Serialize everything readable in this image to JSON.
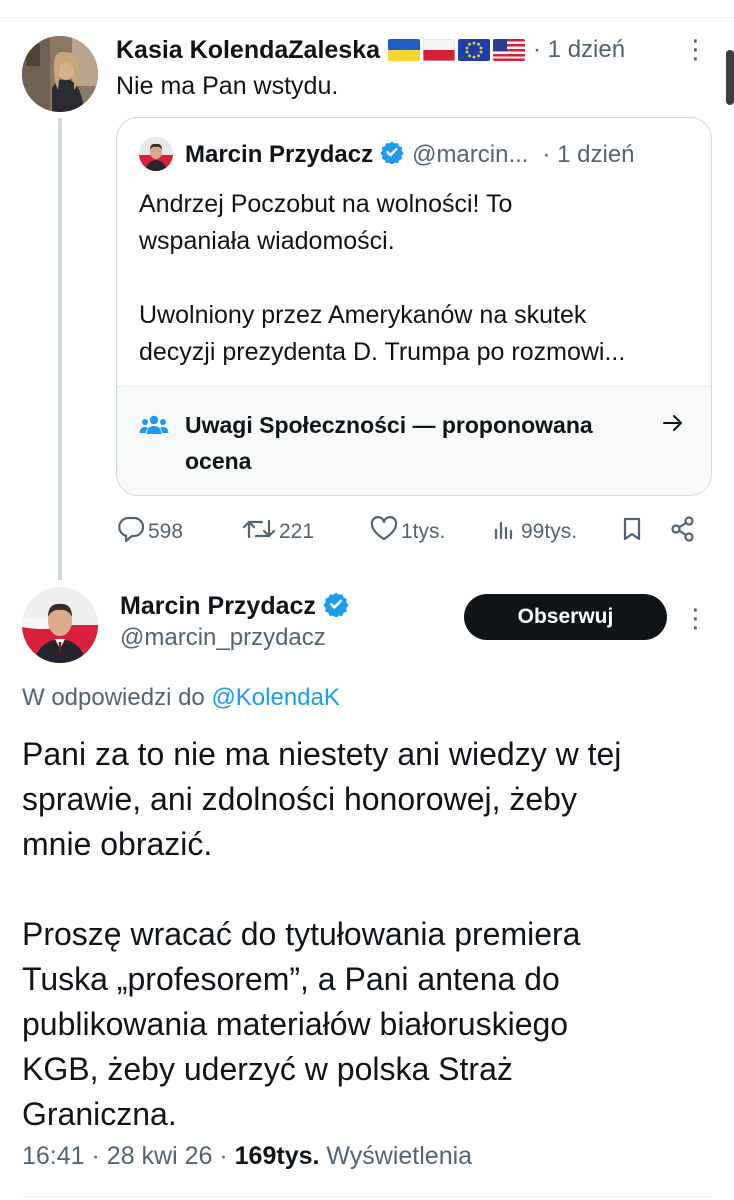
{
  "quoted_reply": {
    "author_name": "Kasia KolendaZaleska",
    "flags": [
      "flag-ukraine-icon",
      "flag-poland-icon",
      "flag-eu-icon",
      "flag-usa-icon"
    ],
    "time": "· 1 dzień",
    "text": "Nie ma Pan wstydu.",
    "quote": {
      "author_name": "Marcin Przydacz",
      "handle": "@marcin...",
      "time": "· 1 dzień",
      "paragraphs": [
        [
          "Andrzej Poczobut na wolności! To",
          "wspaniała wiadomości."
        ],
        [
          "Uwolniony przez Amerykanów na skutek",
          "decyzji prezydenta D. Trumpa po rozmowi..."
        ]
      ],
      "community_notes_label": "Uwagi Społeczności — proponowana ocena"
    },
    "actions": {
      "replies": "598",
      "reposts": "221",
      "likes": "1tys.",
      "views": "99tys."
    }
  },
  "main_tweet": {
    "author_name": "Marcin Przydacz",
    "handle": "@marcin_przydacz",
    "follow_label": "Obserwuj",
    "reply_to_prefix": "W odpowiedzi do",
    "reply_to_mention": "@KolendaK",
    "paragraphs": [
      [
        "Pani za to nie ma niestety ani wiedzy w tej",
        "sprawie, ani zdolności honorowej, żeby",
        "mnie obrazić."
      ],
      [
        "Proszę wracać do tytułowania premiera",
        "Tuska „profesorem”, a Pani antena do",
        "publikowania materiałów białoruskiego",
        "KGB, żeby uderzyć w polska Straż",
        "Graniczna."
      ]
    ],
    "time": "16:41",
    "date": "28 kwi 26",
    "views_count": "169tys.",
    "views_label": "Wyświetlenia"
  },
  "colors": {
    "text_primary": "#0f1419",
    "text_secondary": "#536471",
    "accent": "#1d9bf0",
    "border": "#cfd9de"
  }
}
